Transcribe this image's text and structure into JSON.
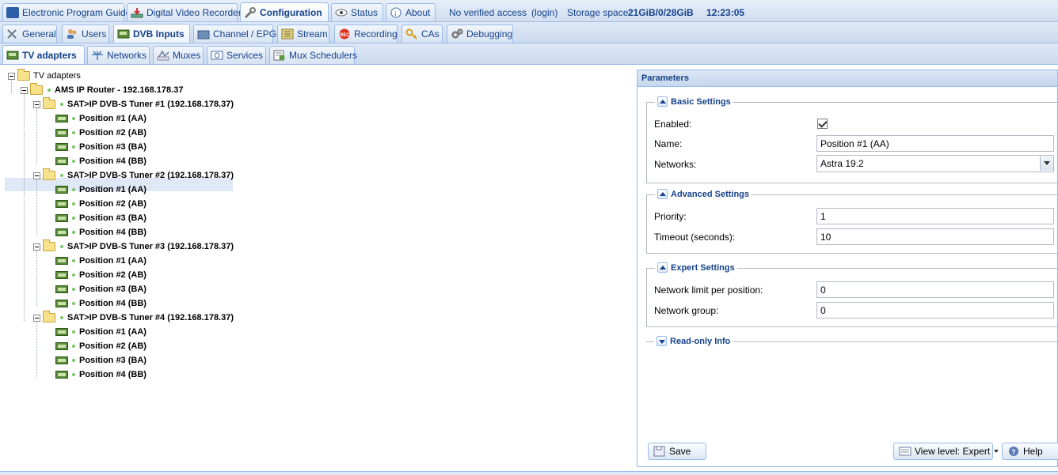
{
  "top_tabs": [
    {
      "label": "Electronic Program Guide",
      "icon": "epg-icon"
    },
    {
      "label": "Digital Video Recorder",
      "icon": "download-icon"
    },
    {
      "label": "Configuration",
      "icon": "wrench-icon"
    },
    {
      "label": "Status",
      "icon": "eye-icon"
    },
    {
      "label": "About",
      "icon": "info-icon"
    }
  ],
  "status": {
    "access": "No verified access",
    "login": "(login)",
    "storage_label": "Storage space:",
    "storage_value": "21GiB/0/28GiB",
    "time": "12:23:05"
  },
  "config_tabs": [
    {
      "label": "General",
      "icon": "tools-icon"
    },
    {
      "label": "Users",
      "icon": "users-icon"
    },
    {
      "label": "DVB Inputs",
      "icon": "card-icon"
    },
    {
      "label": "Channel / EPG",
      "icon": "tv-icon"
    },
    {
      "label": "Stream",
      "icon": "stream-icon"
    },
    {
      "label": "Recording",
      "icon": "rec-icon"
    },
    {
      "label": "CAs",
      "icon": "key-icon"
    },
    {
      "label": "Debugging",
      "icon": "gears-icon"
    }
  ],
  "dvb_tabs": [
    {
      "label": "TV adapters",
      "icon": "card-icon"
    },
    {
      "label": "Networks",
      "icon": "antenna-icon"
    },
    {
      "label": "Muxes",
      "icon": "mux-icon"
    },
    {
      "label": "Services",
      "icon": "services-icon"
    },
    {
      "label": "Mux Schedulers",
      "icon": "scheduler-icon"
    }
  ],
  "tree": {
    "root": "TV adapters",
    "router": "AMS IP Router - 192.168.178.37",
    "tuners": [
      {
        "label": "SAT>IP DVB-S Tuner #1 (192.168.178.37)",
        "positions": [
          "Position #1 (AA)",
          "Position #2 (AB)",
          "Position #3 (BA)",
          "Position #4 (BB)"
        ]
      },
      {
        "label": "SAT>IP DVB-S Tuner #2 (192.168.178.37)",
        "positions": [
          "Position #1 (AA)",
          "Position #2 (AB)",
          "Position #3 (BA)",
          "Position #4 (BB)"
        ]
      },
      {
        "label": "SAT>IP DVB-S Tuner #3 (192.168.178.37)",
        "positions": [
          "Position #1 (AA)",
          "Position #2 (AB)",
          "Position #3 (BA)",
          "Position #4 (BB)"
        ]
      },
      {
        "label": "SAT>IP DVB-S Tuner #4 (192.168.178.37)",
        "positions": [
          "Position #1 (AA)",
          "Position #2 (AB)",
          "Position #3 (BA)",
          "Position #4 (BB)"
        ]
      }
    ]
  },
  "params": {
    "title": "Parameters",
    "basic": {
      "legend": "Basic Settings",
      "enabled_label": "Enabled:",
      "enabled": true,
      "name_label": "Name:",
      "name_value": "Position #1 (AA)",
      "networks_label": "Networks:",
      "networks_value": "Astra 19.2"
    },
    "advanced": {
      "legend": "Advanced Settings",
      "priority_label": "Priority:",
      "priority_value": "1",
      "timeout_label": "Timeout (seconds):",
      "timeout_value": "10"
    },
    "expert": {
      "legend": "Expert Settings",
      "netlimit_label": "Network limit per position:",
      "netlimit_value": "0",
      "netgroup_label": "Network group:",
      "netgroup_value": "0"
    },
    "readonly": {
      "legend": "Read-only Info"
    },
    "save_label": "Save",
    "viewlevel_label": "View level: Expert",
    "help_label": "Help"
  },
  "colors": {
    "accent": "#15428b",
    "border": "#99bbe8",
    "selected": "#dfe8f6"
  }
}
